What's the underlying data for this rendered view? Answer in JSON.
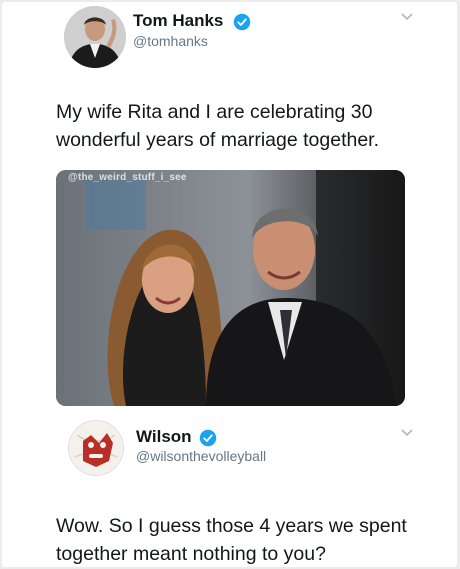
{
  "tweet1": {
    "name": "Tom Hanks",
    "handle": "@tomhanks",
    "text": "My wife Rita and I are celebrating 30 wonderful years of marriage together.",
    "photo_watermark": "@the_weird_stuff_i_see",
    "avatar_icon": "profile-photo",
    "verified_icon": "verified-badge-icon",
    "menu_icon": "chevron-down-icon"
  },
  "tweet2": {
    "name": "Wilson",
    "handle": "@wilsonthevolleyball",
    "text": "Wow. So I guess those 4 years we spent together meant nothing to you?",
    "avatar_icon": "volleyball-face",
    "verified_icon": "verified-badge-icon",
    "menu_icon": "chevron-down-icon"
  },
  "colors": {
    "verified": "#1da1f2",
    "text": "#14171a",
    "handle": "#657786"
  }
}
